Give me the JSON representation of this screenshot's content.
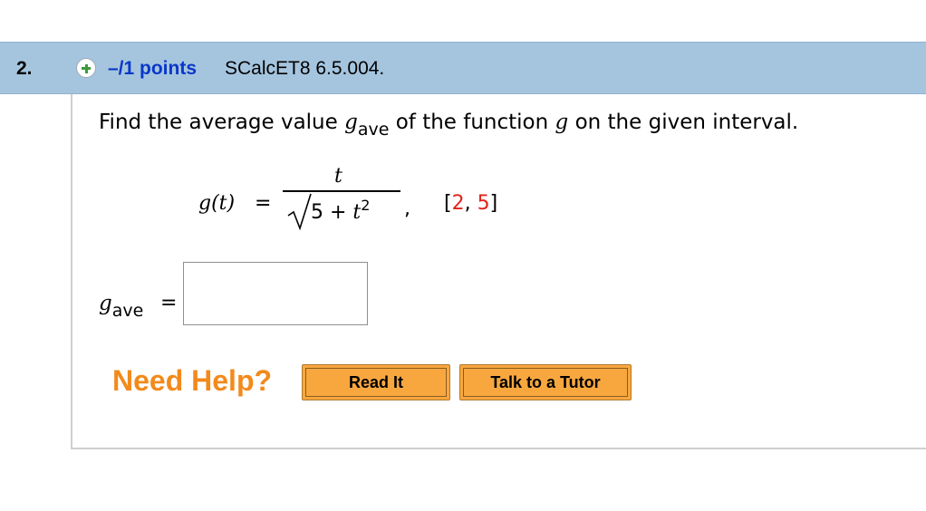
{
  "header": {
    "number": "2.",
    "points": "–/1 points",
    "code": "SCalcET8 6.5.004."
  },
  "question": {
    "prompt_start": "Find the average value ",
    "gave_g": "g",
    "gave_sub": "ave",
    "prompt_end": " of the function ",
    "prompt_g": "g",
    "prompt_tail": " on the given interval.",
    "function_lhs": "g(t)",
    "equals": "=",
    "numerator": "t",
    "denominator_left": "5 + ",
    "denominator_var": "t",
    "denominator_exp": "2",
    "comma": ",",
    "interval_open": "[",
    "interval_a": "2",
    "interval_sep": ", ",
    "interval_b": "5",
    "interval_close": "]"
  },
  "answer": {
    "label_g": "g",
    "label_sub": "ave",
    "equals": "=",
    "value": ""
  },
  "help": {
    "label": "Need Help?",
    "read_it": "Read It",
    "talk_tutor": "Talk to a Tutor"
  },
  "colors": {
    "header_bg": "#a5c5df",
    "points_blue": "#0a37c7",
    "plus_green": "#3c9a3c",
    "interval_red": "#e2231a",
    "help_orange": "#f28a1b",
    "button_orange": "#f8a73f"
  },
  "icons": {
    "add": "plus-circle-icon"
  }
}
